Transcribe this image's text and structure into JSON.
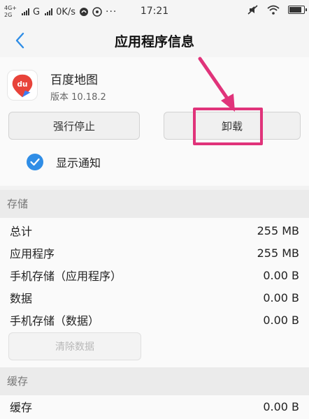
{
  "status_bar": {
    "net_top": "4G+",
    "net_bottom": "2G",
    "carrier": "G",
    "speed": "0K/s",
    "time": "17:21",
    "battery_level": 0.85
  },
  "header": {
    "title": "应用程序信息"
  },
  "app": {
    "name": "百度地图",
    "version": "版本 10.18.2",
    "icon_text": "du"
  },
  "buttons": {
    "force_stop": "强行停止",
    "uninstall": "卸载"
  },
  "notifications": {
    "label": "显示通知",
    "checked": true
  },
  "storage": {
    "title": "存储",
    "rows": [
      {
        "label": "总计",
        "value": "255 MB"
      },
      {
        "label": "应用程序",
        "value": "255 MB"
      },
      {
        "label": "手机存储（应用程序）",
        "value": "0.00 B"
      },
      {
        "label": "数据",
        "value": "0.00 B"
      },
      {
        "label": "手机存储（数据）",
        "value": "0.00 B"
      }
    ],
    "clear_button": "清除数据"
  },
  "cache": {
    "title": "缓存",
    "rows": [
      {
        "label": "缓存",
        "value": "0.00 B"
      }
    ]
  },
  "colors": {
    "accent": "#2f8de6",
    "highlight": "#e0337a"
  }
}
